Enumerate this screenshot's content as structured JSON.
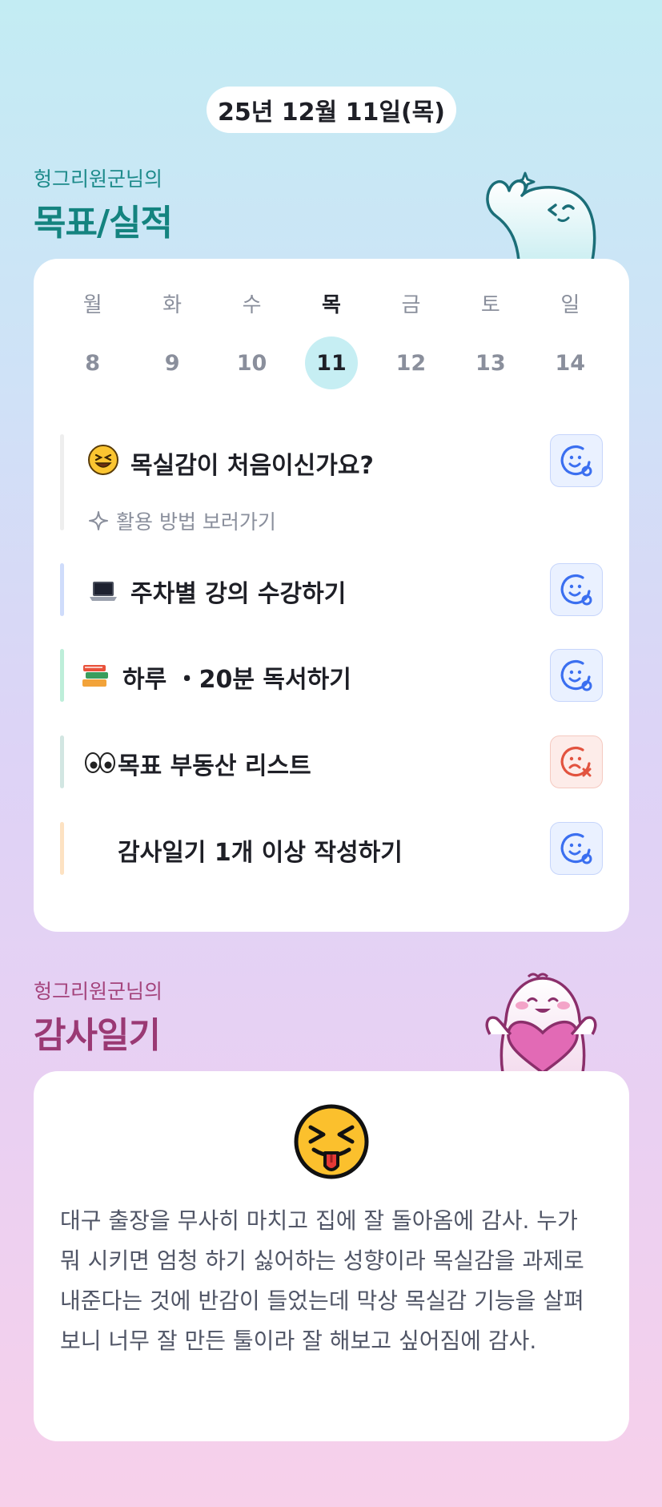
{
  "date": "25년 12월 11일(목)",
  "goals_section": {
    "subtitle": "헝그리원군님의",
    "title": "목표/실적"
  },
  "week": {
    "days": [
      "월",
      "화",
      "수",
      "목",
      "금",
      "토",
      "일"
    ],
    "dates": [
      "8",
      "9",
      "10",
      "11",
      "12",
      "13",
      "14"
    ],
    "selected_index": 3
  },
  "goals": [
    {
      "emoji": "laughing-face-icon",
      "title": "목실감이 처음이신가요?",
      "status": "done",
      "bar_color": "#eeeeee",
      "help_link": "활용 방법 보러가기"
    },
    {
      "emoji": "laptop-icon",
      "title": "주차별 강의 수강하기",
      "status": "done",
      "bar_color": "#cfdcfb"
    },
    {
      "emoji": "books-icon",
      "title": "하루 ・20분 독서하기",
      "status": "done",
      "bar_color": "#bdeed9"
    },
    {
      "emoji": "eyes-icon",
      "title": "목표 부동산 리스트",
      "status": "failed",
      "bar_color": "#d2e6e2"
    },
    {
      "emoji": "",
      "title": "감사일기 1개 이상 작성하기",
      "status": "done",
      "bar_color": "#fde2c2"
    }
  ],
  "diary_section": {
    "subtitle": "헝그리원군님의",
    "title": "감사일기"
  },
  "diary": {
    "mood_icon": "tongue-out-squint-face-icon",
    "text": "대구 출장을 무사히 마치고 집에 잘 돌아옴에 감사. 누가 뭐 시키면 엄청 하기 싫어하는 성향이라 목실감을 과제로 내준다는 것에 반감이 들었는데 막상 목실감 기능을 살펴보니 너무 잘 만든 툴이라 잘 해보고 싶어짐에 감사."
  },
  "colors": {
    "accent_teal": "#14837f",
    "accent_plum": "#9a3974",
    "status_ok": "#3b6ff0",
    "status_fail": "#e2533f"
  }
}
